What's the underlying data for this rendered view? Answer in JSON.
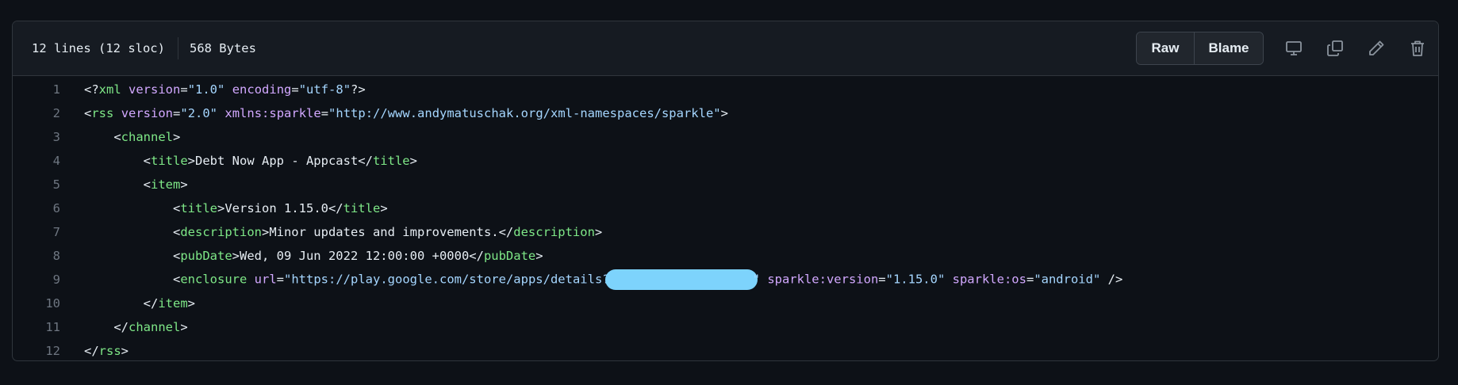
{
  "file": {
    "lines_info": "12 lines (12 sloc)",
    "size": "568 Bytes"
  },
  "toolbar": {
    "raw_label": "Raw",
    "blame_label": "Blame",
    "icons": [
      "desktop-icon",
      "copy-icon",
      "pencil-icon",
      "trash-icon"
    ]
  },
  "colors": {
    "background": "#0d1117",
    "header": "#161b22",
    "border": "#30363d",
    "tag": "#7ee787",
    "attribute": "#d2a8ff",
    "string": "#a5d6ff",
    "line_number": "#6e7681",
    "redaction": "#7dd3fc"
  },
  "code_lines": [
    {
      "n": "1",
      "tokens": [
        {
          "t": "p",
          "v": "<?"
        },
        {
          "t": "tag",
          "v": "xml"
        },
        {
          "t": "p",
          "v": " "
        },
        {
          "t": "attr",
          "v": "version"
        },
        {
          "t": "p",
          "v": "="
        },
        {
          "t": "str",
          "v": "\"1.0\""
        },
        {
          "t": "p",
          "v": " "
        },
        {
          "t": "attr",
          "v": "encoding"
        },
        {
          "t": "p",
          "v": "="
        },
        {
          "t": "str",
          "v": "\"utf-8\""
        },
        {
          "t": "p",
          "v": "?>"
        }
      ]
    },
    {
      "n": "2",
      "tokens": [
        {
          "t": "p",
          "v": "<"
        },
        {
          "t": "tag",
          "v": "rss"
        },
        {
          "t": "p",
          "v": " "
        },
        {
          "t": "attr",
          "v": "version"
        },
        {
          "t": "p",
          "v": "="
        },
        {
          "t": "str",
          "v": "\"2.0\""
        },
        {
          "t": "p",
          "v": " "
        },
        {
          "t": "attr",
          "v": "xmlns:sparkle"
        },
        {
          "t": "p",
          "v": "="
        },
        {
          "t": "str",
          "v": "\"http://www.andymatuschak.org/xml-namespaces/sparkle\""
        },
        {
          "t": "p",
          "v": ">"
        }
      ]
    },
    {
      "n": "3",
      "tokens": [
        {
          "t": "p",
          "v": "    <"
        },
        {
          "t": "tag",
          "v": "channel"
        },
        {
          "t": "p",
          "v": ">"
        }
      ]
    },
    {
      "n": "4",
      "tokens": [
        {
          "t": "p",
          "v": "        <"
        },
        {
          "t": "tag",
          "v": "title"
        },
        {
          "t": "p",
          "v": ">Debt Now App - Appcast</"
        },
        {
          "t": "tag",
          "v": "title"
        },
        {
          "t": "p",
          "v": ">"
        }
      ]
    },
    {
      "n": "5",
      "tokens": [
        {
          "t": "p",
          "v": "        <"
        },
        {
          "t": "tag",
          "v": "item"
        },
        {
          "t": "p",
          "v": ">"
        }
      ]
    },
    {
      "n": "6",
      "tokens": [
        {
          "t": "p",
          "v": "            <"
        },
        {
          "t": "tag",
          "v": "title"
        },
        {
          "t": "p",
          "v": ">Version 1.15.0</"
        },
        {
          "t": "tag",
          "v": "title"
        },
        {
          "t": "p",
          "v": ">"
        }
      ]
    },
    {
      "n": "7",
      "tokens": [
        {
          "t": "p",
          "v": "            <"
        },
        {
          "t": "tag",
          "v": "description"
        },
        {
          "t": "p",
          "v": ">Minor updates and improvements.</"
        },
        {
          "t": "tag",
          "v": "description"
        },
        {
          "t": "p",
          "v": ">"
        }
      ]
    },
    {
      "n": "8",
      "tokens": [
        {
          "t": "p",
          "v": "            <"
        },
        {
          "t": "tag",
          "v": "pubDate"
        },
        {
          "t": "p",
          "v": ">Wed, 09 Jun 2022 12:00:00 +0000</"
        },
        {
          "t": "tag",
          "v": "pubDate"
        },
        {
          "t": "p",
          "v": ">"
        }
      ]
    },
    {
      "n": "9",
      "tokens": [
        {
          "t": "p",
          "v": "            <"
        },
        {
          "t": "tag",
          "v": "enclosure"
        },
        {
          "t": "p",
          "v": " "
        },
        {
          "t": "attr",
          "v": "url"
        },
        {
          "t": "p",
          "v": "="
        },
        {
          "t": "str",
          "v": "\"https://play.google.com/store/apps/details?"
        },
        {
          "t": "redact",
          "v": ""
        },
        {
          "t": "str",
          "v": "\""
        },
        {
          "t": "p",
          "v": " "
        },
        {
          "t": "attr",
          "v": "sparkle:version"
        },
        {
          "t": "p",
          "v": "="
        },
        {
          "t": "str",
          "v": "\"1.15.0\""
        },
        {
          "t": "p",
          "v": " "
        },
        {
          "t": "attr",
          "v": "sparkle:os"
        },
        {
          "t": "p",
          "v": "="
        },
        {
          "t": "str",
          "v": "\"android\""
        },
        {
          "t": "p",
          "v": " />"
        }
      ]
    },
    {
      "n": "10",
      "tokens": [
        {
          "t": "p",
          "v": "        </"
        },
        {
          "t": "tag",
          "v": "item"
        },
        {
          "t": "p",
          "v": ">"
        }
      ]
    },
    {
      "n": "11",
      "tokens": [
        {
          "t": "p",
          "v": "    </"
        },
        {
          "t": "tag",
          "v": "channel"
        },
        {
          "t": "p",
          "v": ">"
        }
      ]
    },
    {
      "n": "12",
      "tokens": [
        {
          "t": "p",
          "v": "</"
        },
        {
          "t": "tag",
          "v": "rss"
        },
        {
          "t": "p",
          "v": ">"
        }
      ]
    }
  ]
}
